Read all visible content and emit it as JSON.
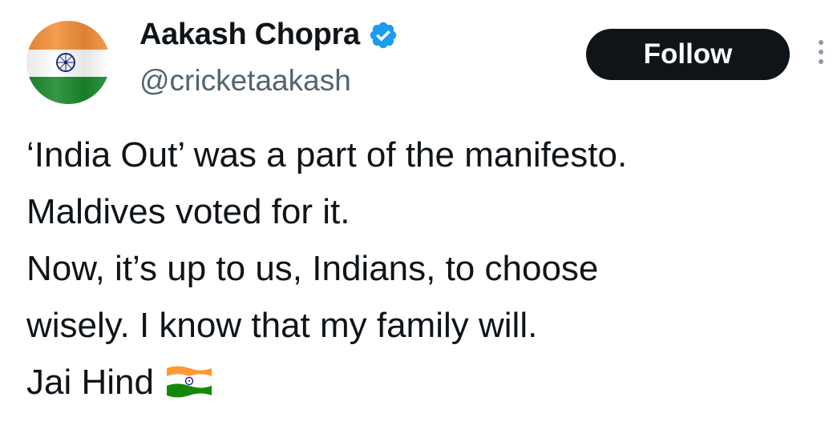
{
  "author": {
    "display_name": "Aakash Chopra",
    "handle": "@cricketaakash",
    "verified": true,
    "avatar_icon": "india-flag-avatar"
  },
  "actions": {
    "follow_label": "Follow",
    "more_icon": "vertical-ellipsis-icon"
  },
  "tweet": {
    "lines": [
      "‘India Out’ was a part of the manifesto.",
      "Maldives voted for it.",
      "Now, it’s up to us, Indians, to choose",
      "wisely. I know that my family will.",
      "Jai Hind"
    ],
    "trailing_emoji": "india-flag-emoji"
  },
  "colors": {
    "text": "#0f1419",
    "secondary_text": "#536471",
    "button_bg": "#0f1419",
    "verified_blue": "#1d9bf0",
    "saffron": "#ff9933",
    "green": "#138808",
    "chakra_navy": "#000080"
  }
}
